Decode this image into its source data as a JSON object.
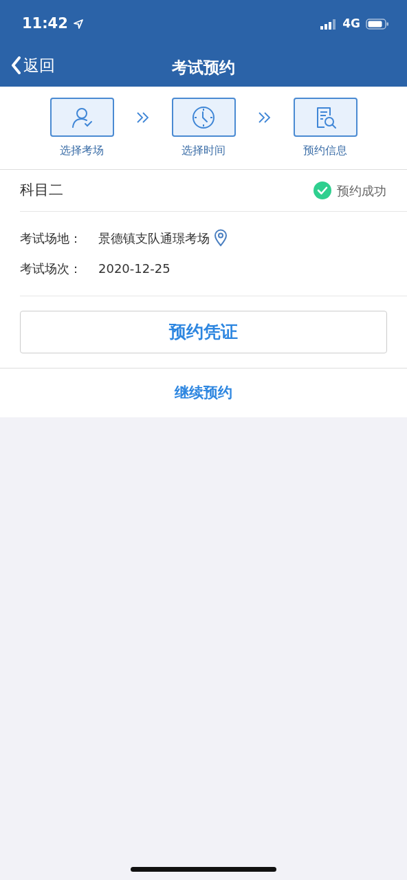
{
  "status_bar": {
    "time": "11:42",
    "network": "4G"
  },
  "nav": {
    "back": "返回",
    "title": "考试预约"
  },
  "steps": [
    {
      "kind": "person",
      "label": "选择考场"
    },
    {
      "kind": "clock",
      "label": "选择时间"
    },
    {
      "kind": "document",
      "label": "预约信息"
    }
  ],
  "subject": {
    "name": "科目二",
    "status": "预约成功"
  },
  "fields": [
    {
      "label": "考试场地：",
      "value": "景德镇支队通璟考场",
      "location_icon": true
    },
    {
      "label": "考试场次：",
      "value": "2020-12-25",
      "location_icon": false
    }
  ],
  "voucher_button": "预约凭证",
  "continue_link": "继续预约"
}
